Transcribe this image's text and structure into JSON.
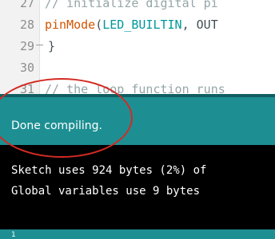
{
  "editor": {
    "lines": [
      {
        "num": "27",
        "comment": "// initialize digital pi"
      },
      {
        "num": "28",
        "keyword": "pinMode",
        "open": "(",
        "constant": "LED_BUILTIN",
        "rest": ", OUT"
      },
      {
        "num": "29",
        "text": "}"
      },
      {
        "num": "30",
        "text": ""
      },
      {
        "num": "31",
        "comment": "// the loop function runs"
      }
    ]
  },
  "status": {
    "message": "Done compiling."
  },
  "console": {
    "lines": [
      "Sketch uses 924 bytes (2%) of",
      "Global variables use 9 bytes"
    ]
  },
  "footer": {
    "line_number": "1"
  },
  "colors": {
    "status_bar": "#1d8f92",
    "console_bg": "#000000",
    "annotation": "#d42a23",
    "keyword": "#d35400",
    "constant": "#00979c"
  }
}
